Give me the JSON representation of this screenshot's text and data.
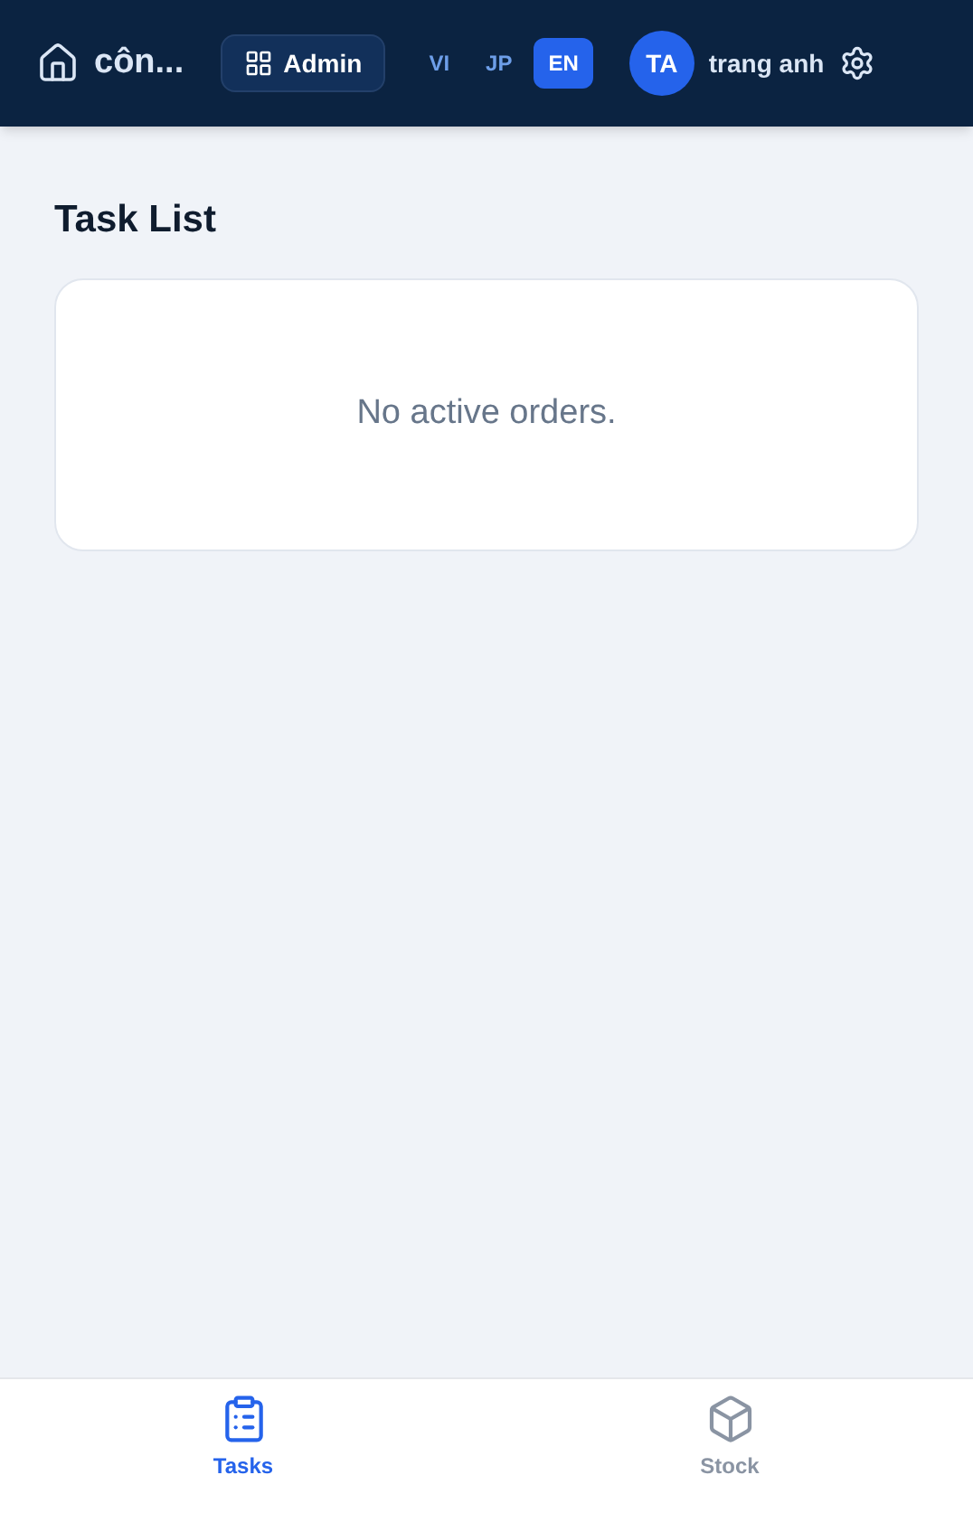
{
  "header": {
    "title": "côn...",
    "admin_button": "Admin",
    "languages": [
      {
        "label": "VI",
        "selected": false
      },
      {
        "label": "JP",
        "selected": false
      },
      {
        "label": "EN",
        "selected": true
      }
    ],
    "avatar": "TA",
    "user_name": "trang anh"
  },
  "page_title": "Task List",
  "empty_message": "No active orders.",
  "bottom_nav": [
    {
      "kind": "tasks",
      "label": "Tasks",
      "selected": true
    },
    {
      "kind": "stock",
      "label": "Stock",
      "selected": false
    }
  ]
}
